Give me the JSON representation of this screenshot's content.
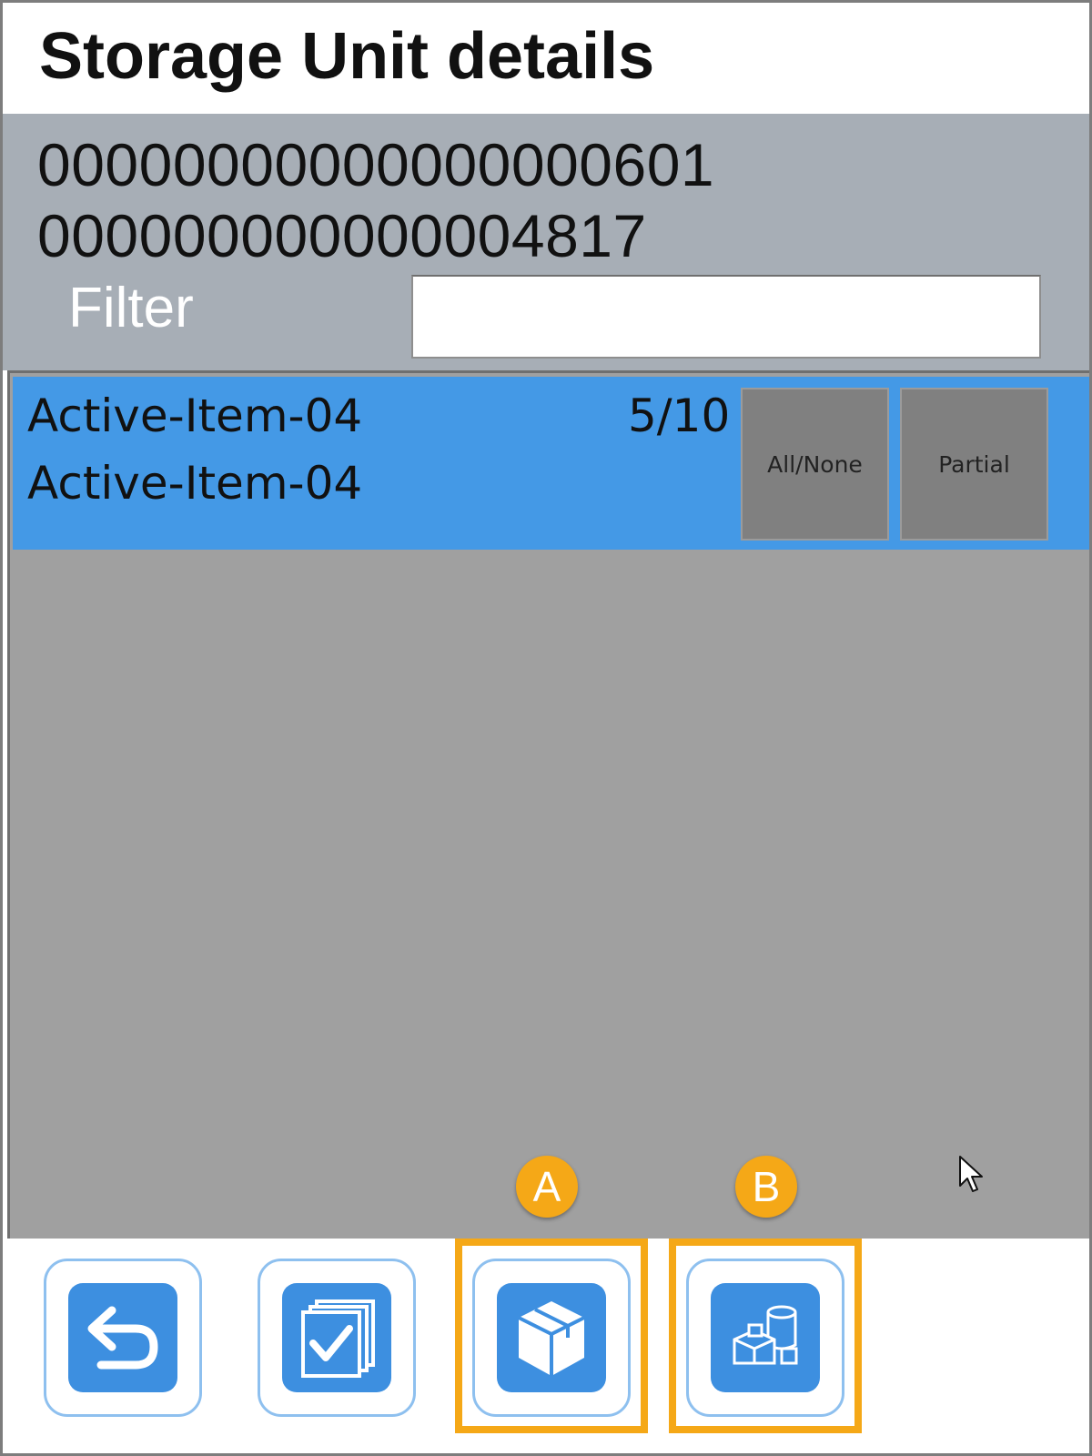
{
  "header": {
    "title": "Storage Unit details"
  },
  "storage_unit": {
    "id_line_1": "00000000000000000601",
    "id_line_2": "000000000000004817"
  },
  "filter": {
    "label": "Filter",
    "value": ""
  },
  "items": [
    {
      "name": "Active-Item-04",
      "description": "Active-Item-04",
      "quantity": "5/10",
      "all_none_label": "All/None",
      "partial_label": "Partial"
    }
  ],
  "toolbar": {
    "buttons": [
      {
        "icon": "back-arrow-icon"
      },
      {
        "icon": "multi-check-icon"
      },
      {
        "icon": "box-icon"
      },
      {
        "icon": "stock-items-icon"
      }
    ]
  },
  "annotations": {
    "badge_a": "A",
    "badge_b": "B",
    "color": "#f5a817"
  },
  "colors": {
    "header_panel": "#a7aeb6",
    "selected_row": "#4499e6",
    "list_background": "#a0a0a0",
    "row_button": "#808080",
    "toolbar_icon": "#3d8fe0"
  }
}
